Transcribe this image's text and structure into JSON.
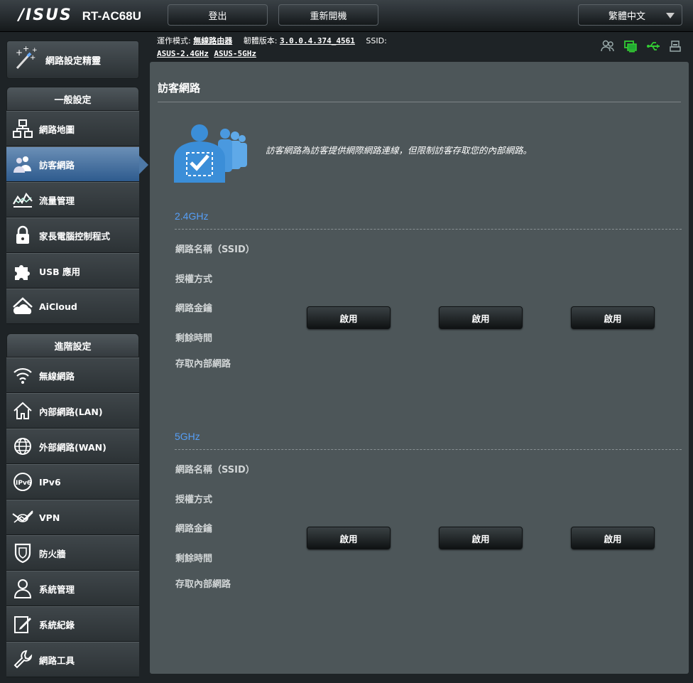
{
  "brand": {
    "logo": "/ISUS",
    "model": "RT-AC68U"
  },
  "topbar": {
    "logout": "登出",
    "reboot": "重新開機",
    "language": "繁體中文"
  },
  "info": {
    "mode_label": "運作模式:",
    "mode_value": "無線路由器",
    "firmware_label": "韌體版本:",
    "firmware_value": "3.0.0.4.374_4561",
    "ssid_label": "SSID:",
    "ssid_24": "ASUS-2.4GHz",
    "ssid_5": "ASUS-5GHz"
  },
  "sidebar": {
    "wizard": "網路設定精靈",
    "general_title": "一般設定",
    "general_items": [
      {
        "label": "網路地圖",
        "icon": "network-map-icon"
      },
      {
        "label": "訪客網路",
        "icon": "guest-network-icon",
        "active": true
      },
      {
        "label": "流量管理",
        "icon": "traffic-manager-icon"
      },
      {
        "label": "家長電腦控制程式",
        "icon": "parental-lock-icon"
      },
      {
        "label": "USB 應用",
        "icon": "usb-puzzle-icon"
      },
      {
        "label": "AiCloud",
        "icon": "aicloud-icon"
      }
    ],
    "advanced_title": "進階設定",
    "advanced_items": [
      {
        "label": "無線網路",
        "icon": "wireless-icon"
      },
      {
        "label": "內部網路(LAN)",
        "icon": "lan-home-icon"
      },
      {
        "label": "外部網路(WAN)",
        "icon": "wan-globe-icon"
      },
      {
        "label": "IPv6",
        "icon": "ipv6-icon"
      },
      {
        "label": "VPN",
        "icon": "vpn-icon"
      },
      {
        "label": "防火牆",
        "icon": "firewall-shield-icon"
      },
      {
        "label": "系統管理",
        "icon": "admin-user-icon"
      },
      {
        "label": "系統紀錄",
        "icon": "system-log-icon"
      },
      {
        "label": "網路工具",
        "icon": "network-tools-icon"
      }
    ]
  },
  "main": {
    "title": "訪客網路",
    "description": "訪客網路為訪客提供網際網路連線，但限制訪客存取您的內部網路。",
    "bands": [
      {
        "name": "2.4GHz",
        "fields": [
          "網路名稱（SSID）",
          "授權方式",
          "網路金鑰",
          "剩餘時間",
          "存取內部網路"
        ],
        "buttons": [
          "啟用",
          "啟用",
          "啟用"
        ]
      },
      {
        "name": "5GHz",
        "fields": [
          "網路名稱（SSID）",
          "授權方式",
          "網路金鑰",
          "剩餘時間",
          "存取內部網路"
        ],
        "buttons": [
          "啟用",
          "啟用",
          "啟用"
        ]
      }
    ]
  },
  "colors": {
    "accent": "#569ff7",
    "active_nav": "#4d78a6",
    "panel": "#4d5659"
  }
}
